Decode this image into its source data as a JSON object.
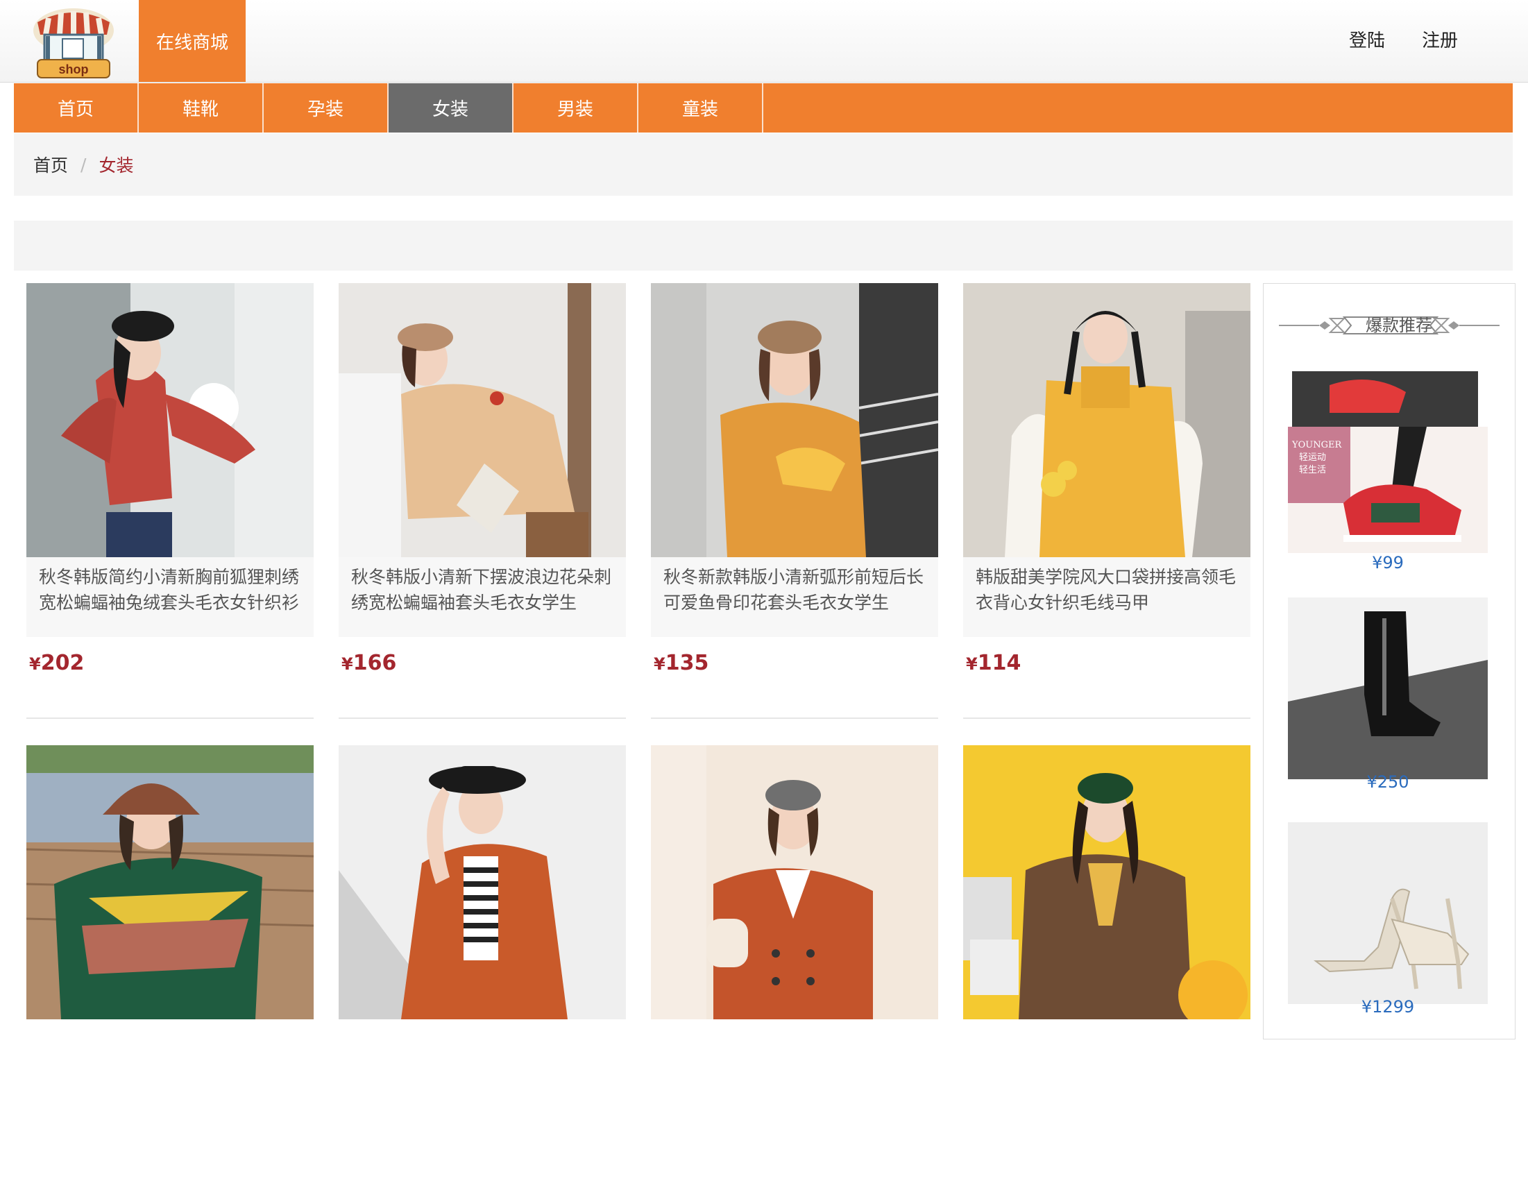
{
  "header": {
    "logo_text": "shop",
    "brand_label": "在线商城",
    "login_label": "登陆",
    "register_label": "注册"
  },
  "nav": [
    {
      "label": "首页",
      "active": false
    },
    {
      "label": "鞋靴",
      "active": false
    },
    {
      "label": "孕装",
      "active": false
    },
    {
      "label": "女装",
      "active": true
    },
    {
      "label": "男装",
      "active": false
    },
    {
      "label": "童装",
      "active": false
    }
  ],
  "breadcrumb": {
    "home": "首页",
    "separator": "/",
    "current": "女装"
  },
  "products": [
    {
      "title": "秋冬韩版简约小清新胸前狐狸刺绣宽松蝙蝠袖兔绒套头毛衣女针织衫",
      "price": "202",
      "currency": "¥"
    },
    {
      "title": "秋冬韩版小清新下摆波浪边花朵刺绣宽松蝙蝠袖套头毛衣女学生",
      "price": "166",
      "currency": "¥"
    },
    {
      "title": "秋冬新款韩版小清新弧形前短后长可爱鱼骨印花套头毛衣女学生",
      "price": "135",
      "currency": "¥"
    },
    {
      "title": "韩版甜美学院风大口袋拼接高领毛衣背心女针织毛线马甲",
      "price": "114",
      "currency": "¥"
    },
    {
      "title": "",
      "price": "",
      "currency": ""
    },
    {
      "title": "",
      "price": "",
      "currency": ""
    },
    {
      "title": "",
      "price": "",
      "currency": ""
    },
    {
      "title": "",
      "price": "",
      "currency": ""
    }
  ],
  "sidebar": {
    "title": "爆款推荐",
    "items": [
      {
        "price": "¥99",
        "watermark_line1": "YOUNGER",
        "watermark_line2": "轻运动",
        "watermark_line3": "轻生活"
      },
      {
        "price": "¥250"
      },
      {
        "price": "¥1299"
      }
    ]
  },
  "colors": {
    "accent": "#f07f2e",
    "nav_active": "#6b6b6b",
    "price": "#a3262e",
    "side_price": "#2a6bbd"
  }
}
